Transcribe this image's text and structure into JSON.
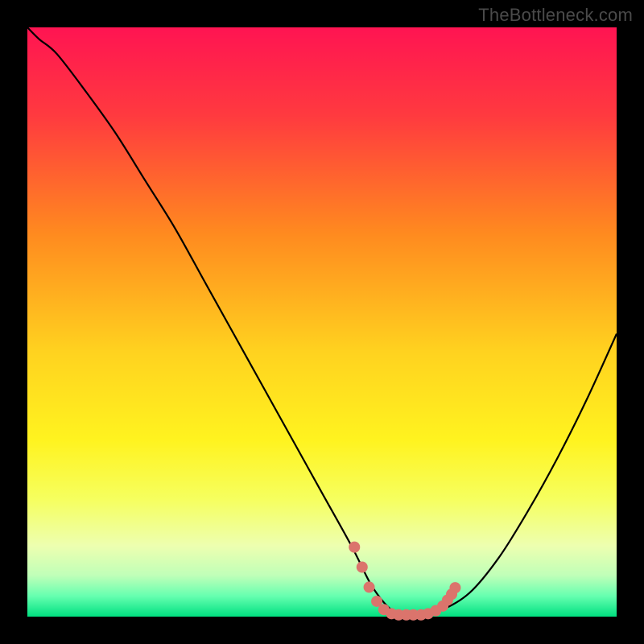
{
  "watermark": "TheBottleneck.com",
  "chart_data": {
    "type": "line",
    "title": "",
    "xlabel": "",
    "ylabel": "",
    "xlim": [
      0,
      100
    ],
    "ylim": [
      0,
      100
    ],
    "gradient_stops": [
      {
        "pos": 0,
        "color": "#ff1452"
      },
      {
        "pos": 15,
        "color": "#ff3a3f"
      },
      {
        "pos": 35,
        "color": "#ff8a1f"
      },
      {
        "pos": 55,
        "color": "#ffd21f"
      },
      {
        "pos": 70,
        "color": "#fff31f"
      },
      {
        "pos": 80,
        "color": "#f6ff5e"
      },
      {
        "pos": 88,
        "color": "#edffb0"
      },
      {
        "pos": 93,
        "color": "#c0ffb8"
      },
      {
        "pos": 96.5,
        "color": "#66ffb0"
      },
      {
        "pos": 100,
        "color": "#00e080"
      }
    ],
    "series": [
      {
        "name": "bottleneck-curve",
        "color": "#000000",
        "x": [
          0,
          2,
          5,
          10,
          15,
          20,
          25,
          30,
          35,
          40,
          45,
          50,
          55,
          58,
          60,
          62,
          64,
          66,
          70,
          75,
          80,
          85,
          90,
          95,
          100
        ],
        "y": [
          100,
          98,
          95.5,
          89,
          82,
          74,
          66,
          57,
          48,
          39,
          30,
          21,
          12,
          6,
          3,
          1,
          0.3,
          0.3,
          1,
          4,
          10,
          18,
          27,
          37,
          48
        ]
      }
    ],
    "markers": {
      "name": "sweet-spot",
      "color": "#db746c",
      "radius": 7,
      "points": [
        {
          "x": 55.5,
          "y": 11.8
        },
        {
          "x": 56.8,
          "y": 8.4
        },
        {
          "x": 58.0,
          "y": 5.0
        },
        {
          "x": 59.3,
          "y": 2.6
        },
        {
          "x": 60.5,
          "y": 1.2
        },
        {
          "x": 61.8,
          "y": 0.5
        },
        {
          "x": 63.0,
          "y": 0.3
        },
        {
          "x": 64.3,
          "y": 0.3
        },
        {
          "x": 65.5,
          "y": 0.3
        },
        {
          "x": 66.8,
          "y": 0.3
        },
        {
          "x": 68.0,
          "y": 0.5
        },
        {
          "x": 69.3,
          "y": 1.0
        },
        {
          "x": 70.5,
          "y": 1.8
        },
        {
          "x": 71.3,
          "y": 2.8
        },
        {
          "x": 72.0,
          "y": 3.8
        },
        {
          "x": 72.6,
          "y": 4.9
        }
      ]
    }
  }
}
